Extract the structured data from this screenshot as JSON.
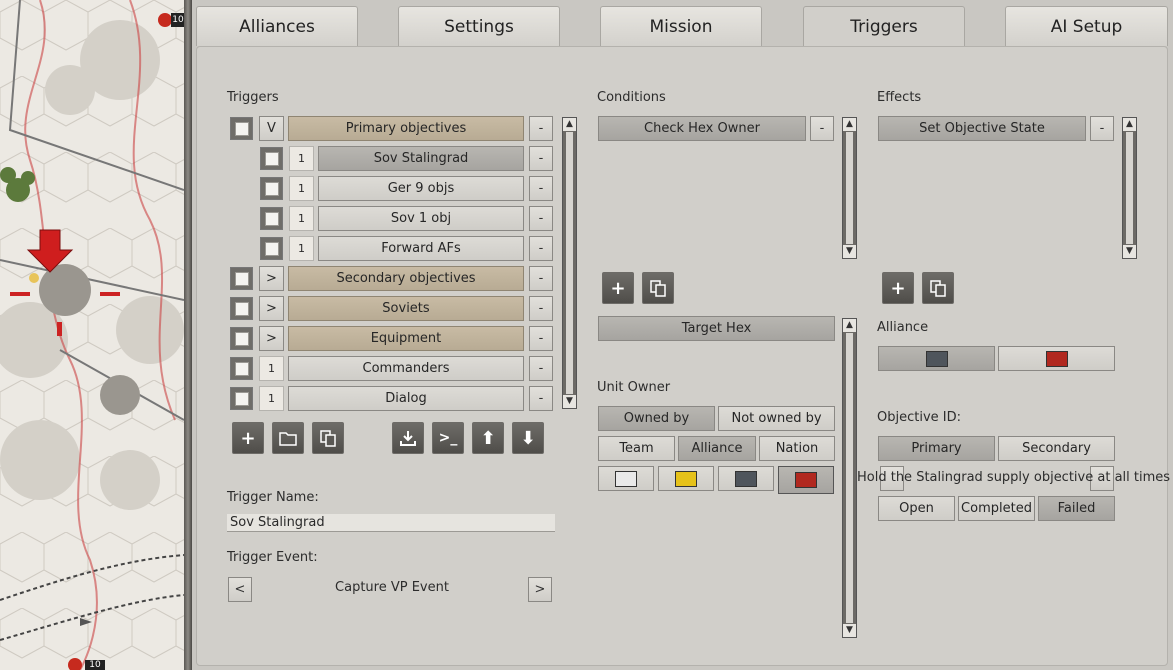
{
  "tabs": [
    "Alliances",
    "Settings",
    "Mission",
    "Triggers",
    "AI Setup"
  ],
  "active_tab": "Triggers",
  "map": {
    "unit_badge_top": "10",
    "unit_badge_bottom": "10"
  },
  "triggers": {
    "section_label": "Triggers",
    "items": [
      {
        "toggle": "V",
        "label": "Primary objectives",
        "style": "tan",
        "indent": 0
      },
      {
        "toggle": "1",
        "label": "Sov Stalingrad",
        "style": "dark",
        "indent": 1
      },
      {
        "toggle": "1",
        "label": "Ger 9 objs",
        "style": "light",
        "indent": 1
      },
      {
        "toggle": "1",
        "label": "Sov 1 obj",
        "style": "light",
        "indent": 1
      },
      {
        "toggle": "1",
        "label": "Forward AFs",
        "style": "light",
        "indent": 1
      },
      {
        "toggle": ">",
        "label": "Secondary objectives",
        "style": "tan",
        "indent": 0
      },
      {
        "toggle": ">",
        "label": "Soviets",
        "style": "tan",
        "indent": 0
      },
      {
        "toggle": ">",
        "label": "Equipment",
        "style": "tan",
        "indent": 0
      },
      {
        "toggle": "1",
        "label": "Commanders",
        "style": "light",
        "indent": 0
      },
      {
        "toggle": "1",
        "label": "Dialog",
        "style": "light",
        "indent": 0
      }
    ],
    "remove_label": "-",
    "name_label": "Trigger Name:",
    "name_value": "Sov Stalingrad",
    "event_label": "Trigger Event:",
    "event_value": "Capture VP Event",
    "event_prev": "<",
    "event_next": ">"
  },
  "conditions": {
    "label": "Conditions",
    "items": [
      "Check Hex Owner"
    ],
    "target": "Target Hex",
    "unit_owner_label": "Unit Owner",
    "owned_by": "Owned by",
    "not_owned_by": "Not owned by",
    "team": "Team",
    "alliance": "Alliance",
    "nation": "Nation",
    "colors": [
      "#e9e9e9",
      "#e6c21a",
      "#4f555c",
      "#b1281f"
    ],
    "selected_color_index": 3
  },
  "effects": {
    "label": "Effects",
    "items": [
      "Set Objective State"
    ],
    "alliance_label": "Alliance",
    "alliance_colors": [
      "#4f555c",
      "#b1281f"
    ],
    "objective_id_label": "Objective ID:",
    "primary": "Primary",
    "secondary": "Secondary",
    "objective_text": "Hold the Stalingrad supply objective at all times",
    "states": [
      "Open",
      "Completed",
      "Failed"
    ],
    "selected_state": "Failed"
  }
}
